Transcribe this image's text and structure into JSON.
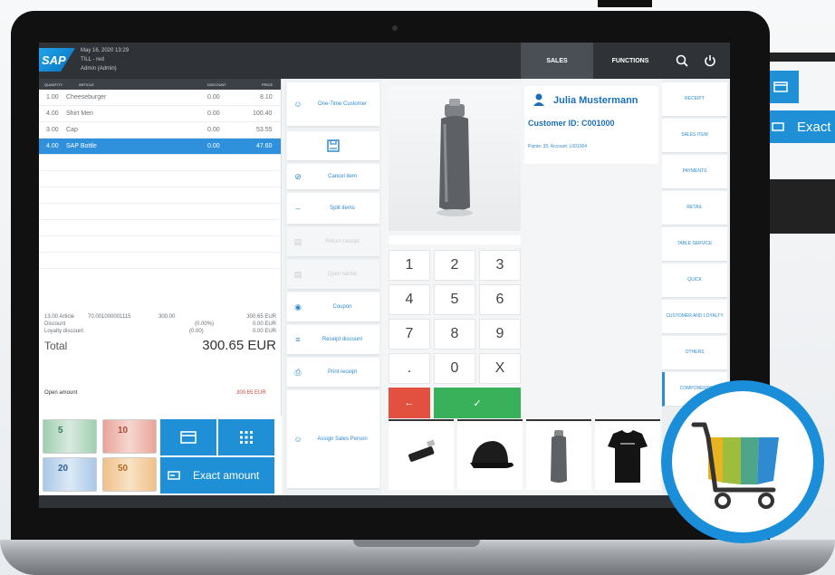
{
  "background": {
    "exact_amount_label": "Exact a"
  },
  "topbar": {
    "logo": "SAP",
    "system_lines": [
      "May 16, 2020 13:29",
      "TILL - red",
      "Admin (Admin)"
    ],
    "tabs": [
      {
        "label": "SALES"
      },
      {
        "label": "FUNCTIONS"
      }
    ]
  },
  "receipt": {
    "headers": [
      "QUANTITY",
      "ARTICLE",
      "DISCOUNT",
      "PRICE"
    ],
    "rows": [
      {
        "qty": "1.00",
        "article": "Cheeseburger",
        "discount": "0.00",
        "price": "8.10"
      },
      {
        "qty": "4.00",
        "article": "Shirt Men",
        "discount": "0.00",
        "price": "100.40"
      },
      {
        "qty": "3.00",
        "article": "Cap",
        "discount": "0.00",
        "price": "53.55"
      },
      {
        "qty": "4.00",
        "article": "SAP Bottle",
        "discount": "0.00",
        "price": "47.60"
      }
    ],
    "summary": [
      {
        "label": "13.00 Article",
        "note": "70.001000001115",
        "mid1": "300.00",
        "mid2": "",
        "value": "300.65 EUR"
      },
      {
        "label": "Discount",
        "note": "",
        "mid1": "",
        "mid2": "(0.00%)",
        "value": "0.00 EUR"
      },
      {
        "label": "Loyalty discount",
        "note": "",
        "mid1": "",
        "mid2": "(0.00)",
        "value": "0.00 EUR"
      }
    ],
    "total_label": "Total",
    "total_value": "300.65 EUR",
    "open_amount_label": "Open amount",
    "open_amount_value": "300.65 EUR"
  },
  "payment": {
    "bills": [
      "5",
      "10",
      "20",
      "50"
    ],
    "exact_amount_label": "Exact amount",
    "colors": {
      "accent": "#1f8fd6"
    }
  },
  "actions": [
    {
      "label": "One-Time Customer",
      "icon": "person-icon",
      "disabled": false
    },
    {
      "label": "",
      "icon": "save-icon",
      "disabled": false
    },
    {
      "label": "Cancel item",
      "icon": "cancel-icon",
      "disabled": false
    },
    {
      "label": "Split items",
      "icon": "minus-icon",
      "disabled": false
    },
    {
      "label": "Return receipt",
      "icon": "receipt-icon",
      "disabled": true
    },
    {
      "label": "Open tab/tie",
      "icon": "tab-icon",
      "disabled": true
    },
    {
      "label": "Coupon",
      "icon": "coupon-icon",
      "disabled": false
    },
    {
      "label": "Receipt discount",
      "icon": "list-icon",
      "disabled": false
    },
    {
      "label": "Print receipt",
      "icon": "print-icon",
      "disabled": false
    },
    {
      "label": "Assign Sales Person",
      "icon": "person-icon",
      "disabled": false
    }
  ],
  "keypad": {
    "keys": [
      "1",
      "2",
      "3",
      "4",
      "5",
      "6",
      "7",
      "8",
      "9",
      ".",
      "0",
      "X"
    ],
    "back": "←",
    "ok": "✓"
  },
  "customer": {
    "name": "Julia Mustermann",
    "id": "Customer ID: C001000",
    "points": "Points: 35, Account: L001004"
  },
  "categories": [
    "RECEIPT",
    "SALES ITEM",
    "PAYMENTS",
    "RETAIL",
    "TABLE SERVICE",
    "QUICK",
    "CUSTOMER AND LOYALTY",
    "OTHERS",
    "COMPONENTS"
  ]
}
